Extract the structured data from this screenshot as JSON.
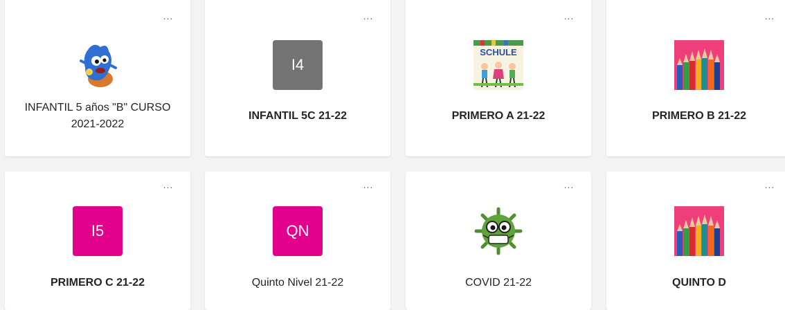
{
  "more_label": "...",
  "colors": {
    "gray_tile": "#737373",
    "magenta_tile": "#e3008c",
    "pencil_bg": "#ef3f7a",
    "covid_green": "#5fa33b"
  },
  "teams": [
    {
      "name": "INFANTIL 5 años \"B\" CURSO 2021-2022",
      "icon": "monster-image-icon"
    },
    {
      "name": "INFANTIL 5C 21-22",
      "initials": "I4",
      "icon": "initials-tile"
    },
    {
      "name": "PRIMERO A 21-22",
      "icon": "schule-kids-drawing-icon",
      "image_text": "SCHULE"
    },
    {
      "name": "PRIMERO B 21-22",
      "icon": "colored-pencils-icon"
    },
    {
      "name": "PRIMERO C 21-22",
      "initials": "I5",
      "icon": "initials-tile"
    },
    {
      "name": "Quinto Nivel 21-22",
      "initials": "QN",
      "icon": "initials-tile"
    },
    {
      "name": "COVID 21-22",
      "icon": "covid-virus-icon"
    },
    {
      "name": "QUINTO D",
      "icon": "colored-pencils-icon"
    }
  ]
}
